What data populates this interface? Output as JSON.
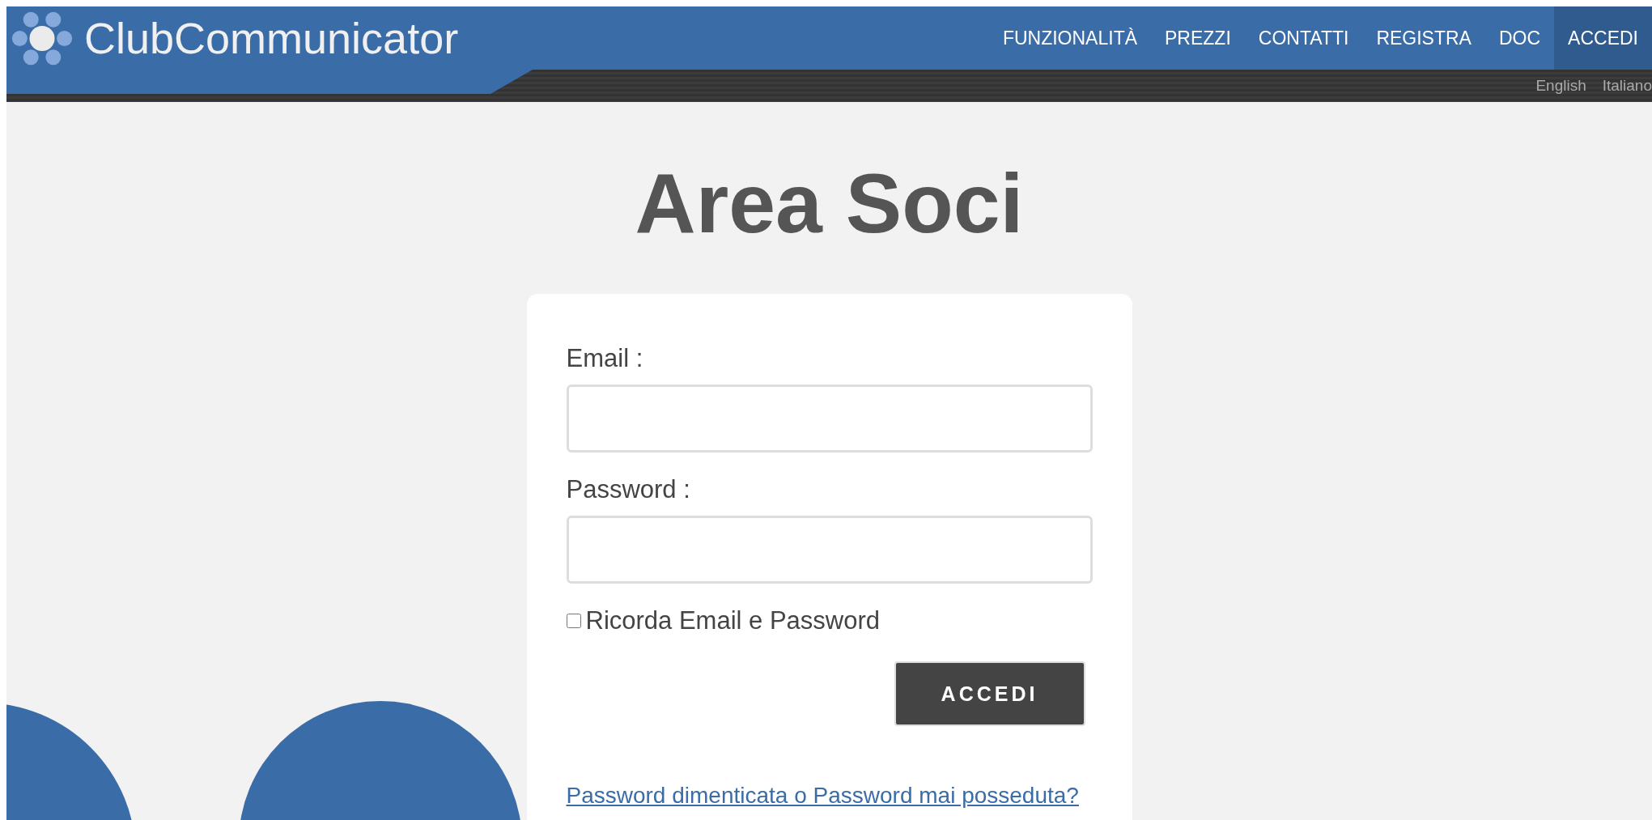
{
  "header": {
    "logo_text": "ClubCommunicator",
    "nav": [
      {
        "label": "FUNZIONALITÀ",
        "selected": false
      },
      {
        "label": "PREZZI",
        "selected": false
      },
      {
        "label": "CONTATTI",
        "selected": false
      },
      {
        "label": "REGISTRA",
        "selected": false
      },
      {
        "label": "DOC",
        "selected": false
      },
      {
        "label": "ACCEDI",
        "selected": true
      }
    ],
    "languages": [
      "English",
      "Italiano"
    ]
  },
  "title": "Area Soci",
  "form": {
    "email_label": "Email :",
    "password_label": "Password :",
    "remember": {
      "label": "Ricorda Email e Password",
      "checked": false
    },
    "submit": "ACCEDI",
    "forgot_link": "Password dimenticata o Password mai posseduta?"
  }
}
